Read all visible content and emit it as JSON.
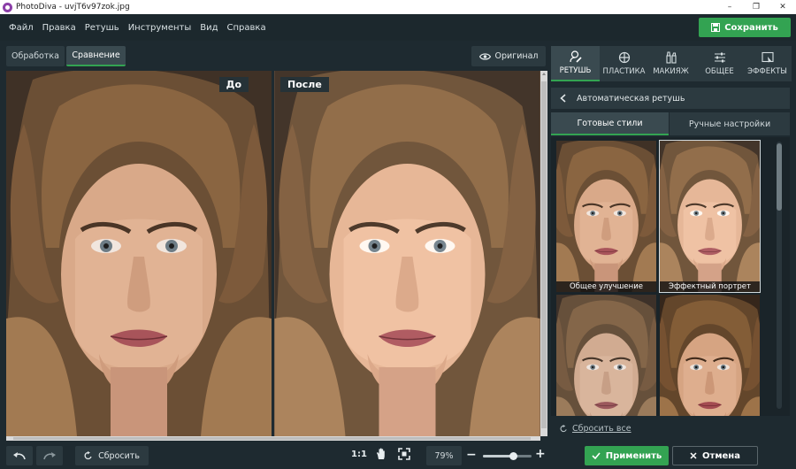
{
  "window": {
    "title": "PhotoDiva - uvjT6v97zok.jpg",
    "controls": [
      "–",
      "❐",
      "✕"
    ]
  },
  "menu": [
    "Файл",
    "Правка",
    "Ретушь",
    "Инструменты",
    "Вид",
    "Справка"
  ],
  "toolbar": {
    "save_label": "Сохранить",
    "processing_tab": "Обработка",
    "compare_tab": "Сравнение",
    "original_label": "Оригинал"
  },
  "canvas": {
    "before_label": "До",
    "after_label": "После"
  },
  "bottom": {
    "reset_label": "Сбросить",
    "zoom_1to1": "1:1",
    "zoom_value": "79%",
    "zoom_minus": "−",
    "zoom_plus": "+",
    "zoom_slider_fraction": 0.62
  },
  "right_panel": {
    "tabs": [
      {
        "label": "РЕТУШЬ",
        "icon": "retouch-icon",
        "active": true
      },
      {
        "label": "ПЛАСТИКА",
        "icon": "crosshair-icon",
        "active": false
      },
      {
        "label": "МАКИЯЖ",
        "icon": "makeup-icon",
        "active": false
      },
      {
        "label": "ОБЩЕЕ",
        "icon": "sliders-icon",
        "active": false
      },
      {
        "label": "ЭФФЕКТЫ",
        "icon": "effects-icon",
        "active": false
      }
    ],
    "header": "Автоматическая ретушь",
    "sub_tabs": [
      "Готовые стили",
      "Ручные настройки"
    ],
    "styles": [
      {
        "caption": "Общее улучшение",
        "selected": false
      },
      {
        "caption": "Эффектный портрет",
        "selected": true
      },
      {
        "caption": "",
        "selected": false
      },
      {
        "caption": "",
        "selected": false
      }
    ],
    "reset_all": "Сбросить все",
    "apply_label": "Применить",
    "cancel_label": "Отмена"
  },
  "colors": {
    "accent": "#33a352",
    "background": "#1e2a30",
    "panel": "#2c3a40"
  }
}
